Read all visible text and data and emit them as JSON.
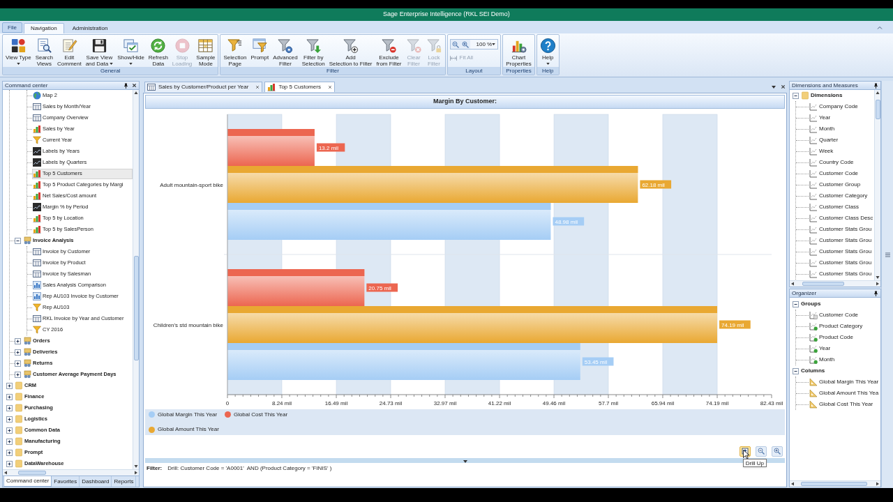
{
  "window": {
    "title": "Sage Enterprise Intelligence (RKL SEI Demo)"
  },
  "menu_tabs": [
    {
      "label": "File",
      "kind": "menu",
      "selected": false
    },
    {
      "label": "Navigation",
      "kind": "tab",
      "selected": true
    },
    {
      "label": "Administration",
      "kind": "tab",
      "selected": false
    }
  ],
  "ribbon": {
    "groups": [
      {
        "kind": "buttons",
        "label": "General",
        "buttons": [
          {
            "label": [
              "View Type"
            ],
            "dropdown": true,
            "disabled": false
          },
          {
            "label": [
              "Search",
              "Views"
            ],
            "dropdown": false,
            "disabled": false
          },
          {
            "label": [
              "Edit",
              "Comment"
            ],
            "dropdown": false,
            "disabled": false
          },
          {
            "label": [
              "Save View",
              "and Data"
            ],
            "dropdown": true,
            "disabled": false
          },
          {
            "label": [
              "Show/Hide"
            ],
            "dropdown": true,
            "disabled": false
          },
          {
            "label": [
              "Refresh",
              "Data"
            ],
            "dropdown": false,
            "disabled": false
          },
          {
            "label": [
              "Stop",
              "Loading"
            ],
            "dropdown": false,
            "disabled": true
          },
          {
            "label": [
              "Sample",
              "Mode"
            ],
            "dropdown": false,
            "disabled": false
          }
        ]
      },
      {
        "kind": "buttons",
        "label": "Filter",
        "buttons": [
          {
            "label": [
              "Selection",
              "Page"
            ],
            "dropdown": false,
            "disabled": false
          },
          {
            "label": [
              "Prompt"
            ],
            "dropdown": false,
            "disabled": false
          },
          {
            "label": [
              "Advanced",
              "Filter"
            ],
            "dropdown": false,
            "disabled": false
          },
          {
            "label": [
              "Filter by",
              "Selection"
            ],
            "dropdown": false,
            "disabled": false
          },
          {
            "label": [
              "Add",
              "Selection to Filter"
            ],
            "dropdown": false,
            "disabled": false
          },
          {
            "label": [
              "Exclude",
              "from Filter"
            ],
            "dropdown": false,
            "disabled": false
          },
          {
            "label": [
              "Clear",
              "Filter"
            ],
            "dropdown": false,
            "disabled": true
          },
          {
            "label": [
              "Lock",
              "Filter"
            ],
            "dropdown": false,
            "disabled": true
          }
        ]
      },
      {
        "kind": "layout",
        "label": "Layout",
        "zoom": {
          "value": "100 %"
        },
        "fit_all": {
          "label": "Fit All",
          "disabled": true
        }
      },
      {
        "kind": "buttons",
        "label": "Properties",
        "buttons": [
          {
            "label": [
              "Chart",
              "Properties"
            ],
            "dropdown": false,
            "disabled": false
          }
        ]
      },
      {
        "kind": "buttons",
        "label": "Help",
        "buttons": [
          {
            "label": [
              "Help"
            ],
            "dropdown": true,
            "disabled": false
          }
        ]
      }
    ]
  },
  "command_center": {
    "title": "Command center",
    "tree": [
      {
        "children": [
          {
            "children": [
              {
                "label": "Map 2",
                "kind": "map",
                "selected": false
              },
              {
                "label": "Sales by Month/Year",
                "kind": "grid",
                "selected": false
              },
              {
                "label": "Company Overview",
                "kind": "grid",
                "selected": false
              },
              {
                "label": "Sales by Year",
                "kind": "chart",
                "selected": false
              },
              {
                "label": "Current Year",
                "kind": "filter",
                "selected": false
              },
              {
                "label": "Labels by Years",
                "kind": "trend",
                "selected": false
              },
              {
                "label": "Labels by Quarters",
                "kind": "trend",
                "selected": false
              },
              {
                "label": "Top 5 Customers",
                "kind": "chart",
                "selected": true
              },
              {
                "label": "Top 5 Product Categories by Margi",
                "kind": "chart",
                "selected": false
              },
              {
                "label": "Net Sales/Cost amount",
                "kind": "chart",
                "selected": false
              },
              {
                "label": "Margin % by Period",
                "kind": "trend",
                "selected": false
              },
              {
                "label": "Top 5 by Location",
                "kind": "chart",
                "selected": false
              },
              {
                "label": "Top 5 by SalesPerson",
                "kind": "chart",
                "selected": false
              }
            ]
          },
          {
            "label": "Invoice Analysis",
            "kind": "group",
            "expanded": true,
            "selected": false,
            "children": [
              {
                "label": "Invoice by Customer",
                "kind": "grid",
                "selected": false
              },
              {
                "label": "Invoice by Product",
                "kind": "grid",
                "selected": false
              },
              {
                "label": "Invoice by Salesman",
                "kind": "grid",
                "selected": false
              },
              {
                "label": "Sales Analysis Comparison",
                "kind": "combo",
                "selected": false
              },
              {
                "label": "Rep AU103 Invoice by Customer",
                "kind": "combo",
                "selected": false
              },
              {
                "label": "Rep AU103",
                "kind": "filter",
                "selected": false
              },
              {
                "label": "RKL Invoice by Year and Customer",
                "kind": "grid",
                "selected": false
              },
              {
                "label": "CY 2016",
                "kind": "filter",
                "selected": false
              }
            ]
          },
          {
            "label": "Orders",
            "kind": "group",
            "expanded": false,
            "selected": false
          },
          {
            "label": "Deliveries",
            "kind": "group",
            "expanded": false,
            "selected": false
          },
          {
            "label": "Returns",
            "kind": "group",
            "expanded": false,
            "selected": false
          },
          {
            "label": "Customer Average Payment Days",
            "kind": "group",
            "expanded": false,
            "selected": false
          }
        ]
      },
      {
        "label": "CRM",
        "kind": "folder",
        "expanded": false,
        "selected": false
      },
      {
        "label": "Finance",
        "kind": "folder",
        "expanded": false,
        "selected": false
      },
      {
        "label": "Purchasing",
        "kind": "folder",
        "expanded": false,
        "selected": false
      },
      {
        "label": "Logistics",
        "kind": "folder",
        "expanded": false,
        "selected": false
      },
      {
        "label": "Common Data",
        "kind": "folder",
        "expanded": false,
        "selected": false
      },
      {
        "label": "Manufacturing",
        "kind": "folder",
        "expanded": false,
        "selected": false
      },
      {
        "label": "Prompt",
        "kind": "folder",
        "expanded": false,
        "selected": false
      },
      {
        "label": "DataWarehouse",
        "kind": "folder",
        "expanded": false,
        "selected": false
      }
    ],
    "tabs": [
      {
        "label": "Command center",
        "selected": true
      },
      {
        "label": "Favorites",
        "selected": false
      },
      {
        "label": "Dashboard",
        "selected": false
      },
      {
        "label": "Reports",
        "selected": false
      }
    ]
  },
  "document_tabs": [
    {
      "label": "Sales by Customer/Product per Year",
      "kind": "grid",
      "selected": false
    },
    {
      "label": "Top 5 Customers",
      "kind": "chart",
      "selected": true
    }
  ],
  "chart_panel": {
    "chart_data": [
      {
        "type": "bar",
        "orientation": "horizontal",
        "title": "Margin By Customer:",
        "categories": [
          "Adult mountain-sport bike",
          "Children's std mountain bike"
        ],
        "series": [
          {
            "name": "Global Margin This Year",
            "color": "#a5cdf5",
            "values": [
              48.98,
              53.45
            ],
            "value_labels": [
              "48.98 mil",
              "53.45 mil"
            ]
          },
          {
            "name": "Global Amount This Year",
            "color": "#e9a832",
            "values": [
              62.18,
              74.19
            ],
            "value_labels": [
              "62.18 mil",
              "74.19 mil"
            ]
          },
          {
            "name": "Global Cost This Year",
            "color": "#ec6650",
            "values": [
              13.2,
              20.75
            ],
            "value_labels": [
              "13.2 mil",
              "20.75 mil"
            ]
          }
        ],
        "xlim": [
          0,
          82.43
        ],
        "xticks": [
          0,
          {
            "value": 8.24,
            "label": "8.24 mil"
          },
          {
            "value": 16.49,
            "label": "16.49 mil"
          },
          {
            "value": 24.73,
            "label": "24.73 mil"
          },
          {
            "value": 32.97,
            "label": "32.97 mil"
          },
          {
            "value": 41.22,
            "label": "41.22 mil"
          },
          {
            "value": 49.46,
            "label": "49.46 mil"
          },
          {
            "value": 57.7,
            "label": "57.7 mil"
          },
          {
            "value": 65.94,
            "label": "65.94 mil"
          },
          {
            "value": 74.19,
            "label": "74.19 mil"
          },
          {
            "value": 82.43,
            "label": "82.43 mil"
          }
        ],
        "data_labels": true
      }
    ],
    "tools": [
      {
        "hovered": true
      },
      {
        "hovered": false
      },
      {
        "hovered": false
      }
    ],
    "tooltip": "Drill Up",
    "filter": {
      "label": "Filter:",
      "text": "Drill: Customer Code = 'A0001'  AND (Product Category = 'FINIS' )"
    }
  },
  "dimensions_panel": {
    "title": "Dimensions and Measures",
    "tree": [
      {
        "label": "Dimensions",
        "kind": "folder",
        "expanded": true,
        "children": [
          {
            "label": "Company Code",
            "kind": "dimension"
          },
          {
            "label": "Year",
            "kind": "dimension"
          },
          {
            "label": "Month",
            "kind": "dimension"
          },
          {
            "label": "Quarter",
            "kind": "dimension"
          },
          {
            "label": "Week",
            "kind": "dimension"
          },
          {
            "label": "Country Code",
            "kind": "dimension"
          },
          {
            "label": "Customer Code",
            "kind": "dimension"
          },
          {
            "label": "Customer Group",
            "kind": "dimension"
          },
          {
            "label": "Customer Category",
            "kind": "dimension"
          },
          {
            "label": "Customer Class",
            "kind": "dimension"
          },
          {
            "label": "Customer Class Desc",
            "kind": "dimension"
          },
          {
            "label": "Customer Stats Grou",
            "kind": "dimension"
          },
          {
            "label": "Customer Stats Grou",
            "kind": "dimension"
          },
          {
            "label": "Customer Stats Grou",
            "kind": "dimension"
          },
          {
            "label": "Customer Stats Grou",
            "kind": "dimension"
          },
          {
            "label": "Customer Stats Grou",
            "kind": "dimension"
          }
        ]
      }
    ]
  },
  "organizer": {
    "title": "Organizer",
    "tree": [
      {
        "label": "Groups",
        "expanded": true,
        "children": [
          {
            "label": "Customer Code",
            "kind": "drilled"
          },
          {
            "label": "Product Category",
            "kind": "grouped"
          },
          {
            "label": "Product Code",
            "kind": "grouped"
          },
          {
            "label": "Year",
            "kind": "grouped"
          },
          {
            "label": "Month",
            "kind": "grouped"
          }
        ]
      },
      {
        "label": "Columns",
        "expanded": true,
        "children": [
          {
            "label": "Global Margin This Year",
            "kind": "measure"
          },
          {
            "label": "Global Amount This Yea",
            "kind": "measure"
          },
          {
            "label": "Global Cost This Year",
            "kind": "measure"
          }
        ]
      }
    ]
  }
}
